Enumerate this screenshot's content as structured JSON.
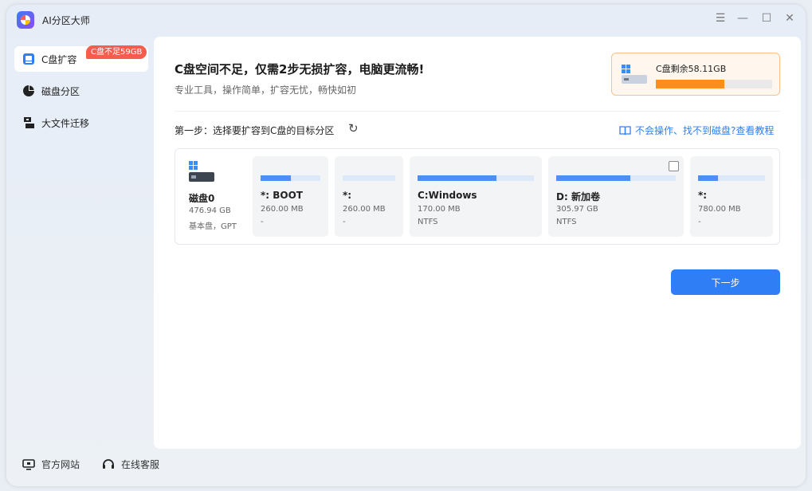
{
  "app": {
    "title": "AI分区大师"
  },
  "window_controls": {
    "menu": "☰",
    "minimize": "—",
    "maximize": "☐",
    "close": "✕"
  },
  "sidebar": {
    "items": [
      {
        "label": "C盘扩容",
        "icon": "c-drive-icon",
        "active": true
      },
      {
        "label": "磁盘分区",
        "icon": "partition-pie-icon",
        "active": false
      },
      {
        "label": "大文件迁移",
        "icon": "file-migrate-icon",
        "active": false
      }
    ],
    "badge": "C盘不足59GB"
  },
  "footer": {
    "website": "官方网站",
    "support": "在线客服"
  },
  "main": {
    "headline": "C盘空间不足，仅需2步无损扩容，电脑更流畅!",
    "subline": "专业工具，操作简单，扩容无忧，畅快如初",
    "c_free": {
      "label": "C盘剩余58.11GB",
      "fill_fraction": 0.59
    },
    "step_label": "第一步：选择要扩容到C盘的目标分区",
    "refresh_icon": "↻",
    "help_link": "不会操作、找不到磁盘?查看教程",
    "disk": {
      "name": "磁盘0",
      "size": "476.94 GB",
      "type": "基本盘，GPT"
    },
    "partitions": [
      {
        "name": "*:  BOOT",
        "size": "260.00 MB",
        "fs": "-",
        "fill": 0.5,
        "checkbox": false
      },
      {
        "name": "*:",
        "size": "260.00 MB",
        "fs": "-",
        "fill": 0.0,
        "checkbox": false
      },
      {
        "name": "C:Windows",
        "size": "170.00 MB",
        "fs": "NTFS",
        "fill": 0.68,
        "checkbox": false
      },
      {
        "name": "D: 新加卷",
        "size": "305.97 GB",
        "fs": "NTFS",
        "fill": 0.62,
        "checkbox": true
      },
      {
        "name": "*:",
        "size": "780.00 MB",
        "fs": "-",
        "fill": 0.3,
        "checkbox": false
      }
    ],
    "next_button": "下一步"
  },
  "colors": {
    "accent": "#2f7ef5",
    "warning": "#ff8d1a",
    "badge": "#f75c4c"
  }
}
